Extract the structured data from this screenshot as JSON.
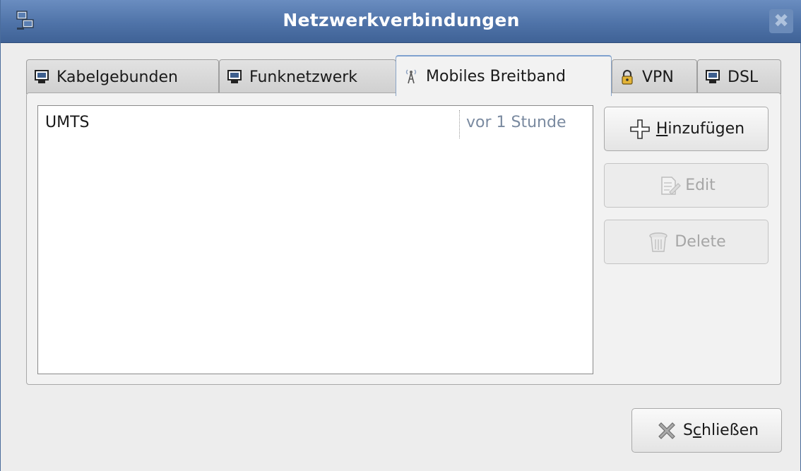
{
  "window": {
    "title": "Netzwerkverbindungen",
    "close_glyph": "✖"
  },
  "tabs": [
    {
      "label": "Kabelgebunden",
      "icon": "network-computer-icon",
      "active": false
    },
    {
      "label": "Funknetzwerk",
      "icon": "network-computer-icon",
      "active": false
    },
    {
      "label": "Mobiles Breitband",
      "icon": "antenna-tower-icon",
      "active": true
    },
    {
      "label": "VPN",
      "icon": "padlock-icon",
      "active": false
    },
    {
      "label": "DSL",
      "icon": "network-computer-icon",
      "active": false
    }
  ],
  "connections": [
    {
      "name": "UMTS",
      "last_used": "vor 1 Stunde"
    }
  ],
  "buttons": {
    "add": {
      "mnemonic": "H",
      "rest": "inzufügen",
      "enabled": true
    },
    "edit": {
      "label": "Edit",
      "enabled": false
    },
    "delete": {
      "label": "Delete",
      "enabled": false
    },
    "close": {
      "before": "S",
      "mnemonic": "c",
      "rest": "hließen",
      "enabled": true
    }
  },
  "colors": {
    "titlebar": "#4f73a8",
    "title_text": "#ffffff",
    "timestamp_text": "#7a8aa0",
    "disabled_text": "#a6a6a6"
  }
}
